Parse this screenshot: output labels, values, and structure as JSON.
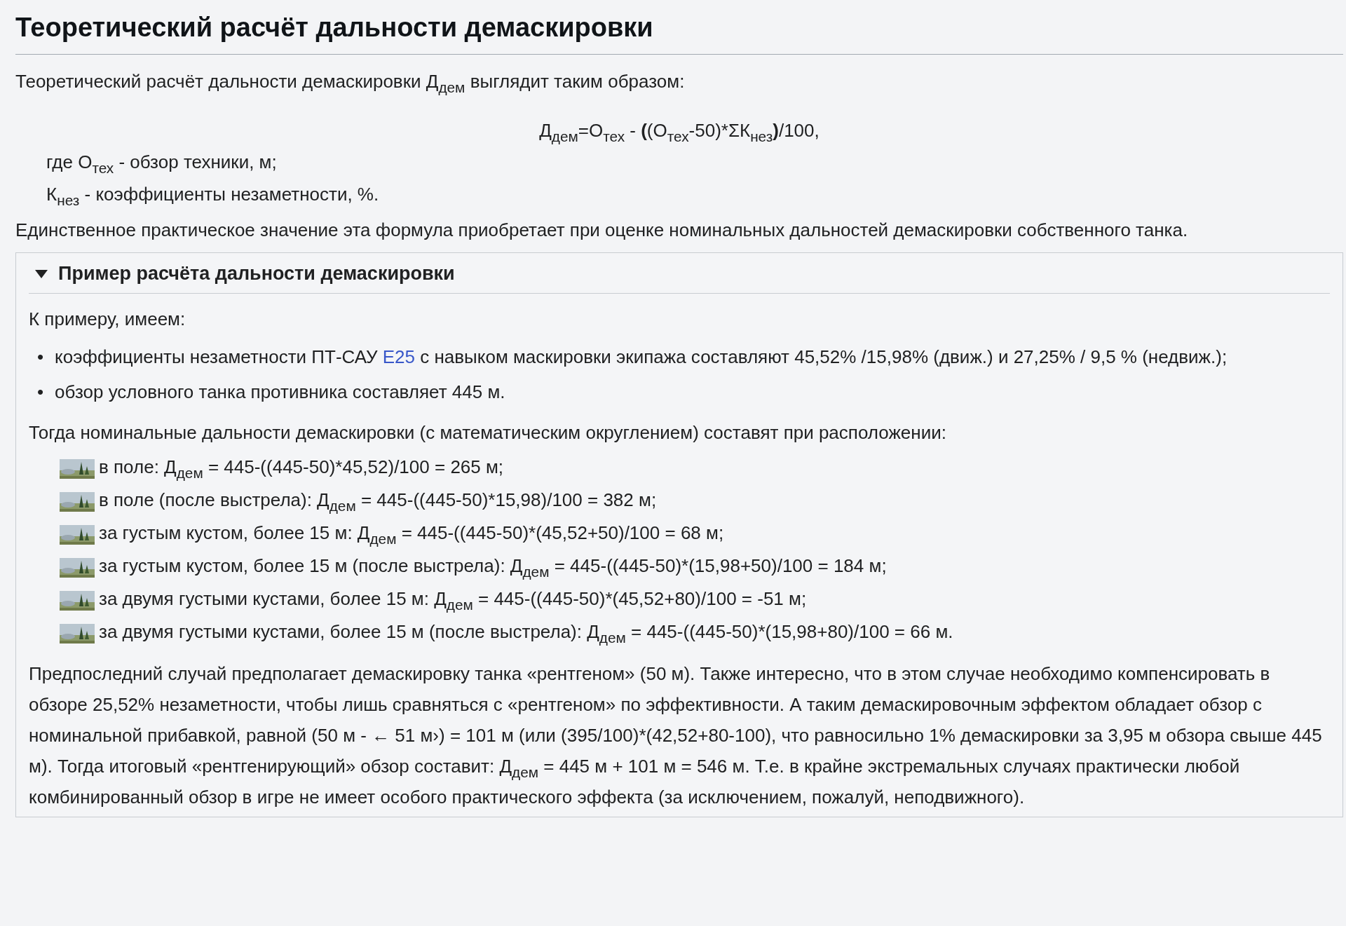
{
  "heading": "Теоретический расчёт дальности демаскировки",
  "intro": "Теоретический расчёт дальности демаскировки Д$_{дем}$ выглядит таким образом:",
  "formula": "Д$_{дем}$=О$_{тех}$ - **(**(О$_{тех}$-50)*ΣК$_{нез}$**)**/100,",
  "definitions": [
    "где О$_{тех}$ - обзор техники, м;",
    "К$_{нез}$ - коэффициенты незаметности, %."
  ],
  "note": "Единственное практическое значение эта формула приобретает при оценке номинальных дальностей демаскировки собственного танка.",
  "example": {
    "title": "Пример расчёта дальности демаскировки",
    "expanded": true,
    "lead": "К примеру, имеем:",
    "bullets": [
      {
        "marker": "•",
        "text": "коэффициенты незаметности ПТ-САУ ",
        "link": "E25",
        "after": " с навыком маскировки экипажа составляют 45,52% /15,98% (движ.) и 27,25% / 9,5 % (недвиж.);"
      },
      {
        "marker": "•",
        "text": "обзор условного танка противника составляет 445 м."
      }
    ],
    "cases_lead": "Тогда номинальные дальности демаскировки (с математическим округлением) составят при расположении:",
    "cases": [
      "в поле: Д$_{дем}$ = 445-((445-50)*45,52)/100 = 265 м;",
      "в поле (после выстрела): Д$_{дем}$ = 445-((445-50)*15,98)/100 = 382 м;",
      "за густым кустом, более 15 м: Д$_{дем}$ = 445-((445-50)*(45,52+50)/100 = 68 м;",
      "за густым кустом, более 15 м (после выстрела): Д$_{дем}$ = 445-((445-50)*(15,98+50)/100 = 184 м;",
      "за двумя густыми кустами, более 15 м: Д$_{дем}$ = 445-((445-50)*(45,52+80)/100 = -51 м;",
      "за двумя густыми кустами, более 15 м (после выстрела): Д$_{дем}$ = 445-((445-50)*(15,98+80)/100 = 66 м."
    ],
    "summary": "Предпоследний случай предполагает демаскировку танка «рентгеном» (50 м). Также интересно, что в этом случае необходимо компенсировать в обзоре 25,52% незаметности, чтобы лишь сравняться с «рентгеном» по эффективности. А таким демаскировочным эффектом обладает обзор с номинальной прибавкой, равной (50 м - ← 51 м›) = 101 м (или (395/100)*(42,52+80-100), что равносильно 1% демаскировки за 3,95 м обзора свыше 445 м). Тогда итоговый «рентгенирующий» обзор составит: Д$_{дем}$ = 445 м + 101 м = 546 м. Т.е. в крайне экстремальных случаях практически любой комбинированный обзор в игре не имеет особого практического эффекта (за исключением, пожалуй, неподвижного)."
  }
}
